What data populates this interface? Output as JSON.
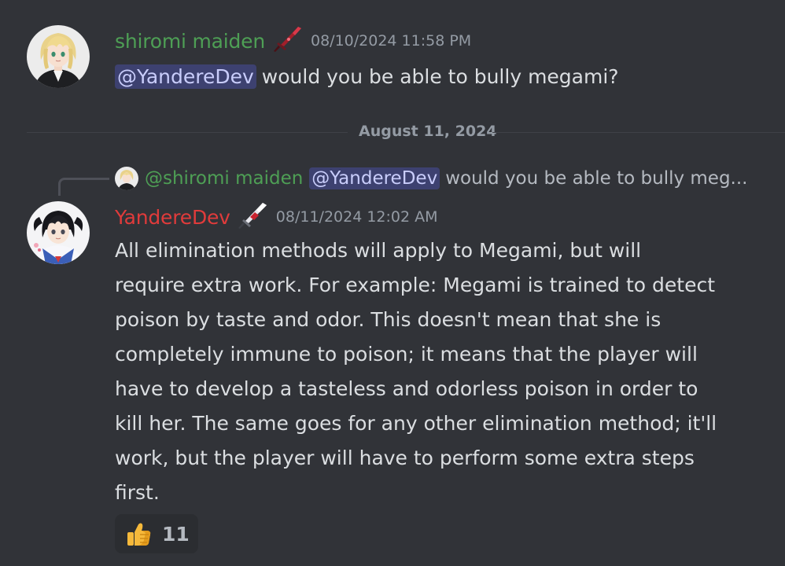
{
  "messages": [
    {
      "author": "shiromi maiden",
      "author_color": "#4e9f55",
      "role_icon": "red-sword-icon",
      "timestamp": "08/10/2024 11:58 PM",
      "mention": "@YandereDev",
      "text": "would you be able to bully megami?"
    },
    {
      "author": "YandereDev",
      "author_color": "#e03b3b",
      "role_icon": "bloody-knife-icon",
      "timestamp": "08/11/2024 12:02 AM",
      "reply": {
        "author": "@shiromi maiden",
        "mention": "@YandereDev",
        "text": "would you be able to bully meg..."
      },
      "body_lines": [
        "All elimination methods will apply to Megami, but will",
        "require extra work. For example: Megami is trained to detect",
        "poison by taste and odor. This doesn't mean that she is",
        "completely immune to poison; it means that the player will",
        "have to develop a tasteless and odorless poison in order to",
        "kill her. The same goes for any other elimination method; it'll",
        "work, but the player will have to perform some extra steps",
        "first."
      ],
      "reaction": {
        "emoji": "thumbs-up-icon",
        "count": "11"
      }
    }
  ],
  "date_divider": "August 11, 2024",
  "colors": {
    "background": "#313338",
    "mention_bg": "rgba(88,101,242,0.30)",
    "mention_text": "#c9cdfb",
    "timestamp": "#949ba4"
  }
}
